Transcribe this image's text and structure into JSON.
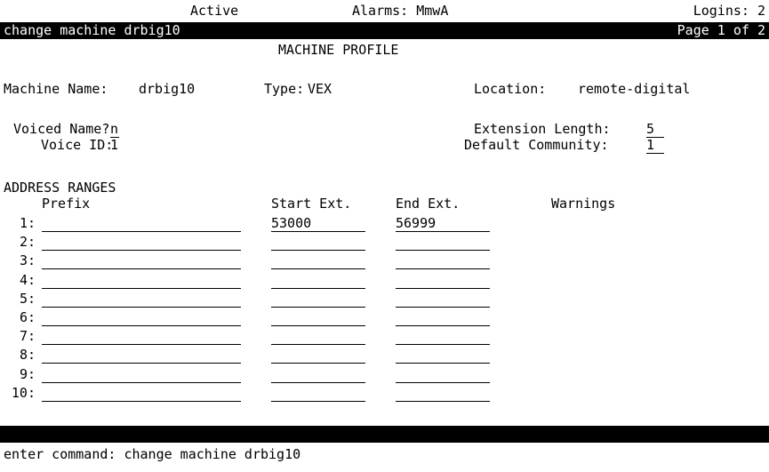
{
  "status": {
    "state": "Active",
    "alarms": "Alarms: MmwA",
    "logins": "Logins: 2"
  },
  "title_bar": {
    "command": "change machine drbig10",
    "page": "Page 1 of 2"
  },
  "form_title": "MACHINE PROFILE",
  "machine": {
    "name_label": "Machine Name:",
    "name_value": "drbig10",
    "type_label": "Type:",
    "type_value": "VEX",
    "location_label": "Location:",
    "location_value": "remote-digital"
  },
  "voice": {
    "voiced_name_label": "Voiced Name?",
    "voiced_name_value": "n",
    "voice_id_label": "Voice ID:",
    "voice_id_value": "1"
  },
  "ext": {
    "length_label": "Extension Length:",
    "length_value": "5",
    "community_label": "Default Community:",
    "community_value": "1"
  },
  "ranges": {
    "section_label": "ADDRESS RANGES",
    "headers": {
      "prefix": "Prefix",
      "start": "Start Ext.",
      "end": "End Ext.",
      "warnings": "Warnings"
    },
    "rows": [
      {
        "num": "1:",
        "prefix": "",
        "start": "53000",
        "end": "56999"
      },
      {
        "num": "2:",
        "prefix": "",
        "start": "",
        "end": ""
      },
      {
        "num": "3:",
        "prefix": "",
        "start": "",
        "end": ""
      },
      {
        "num": "4:",
        "prefix": "",
        "start": "",
        "end": ""
      },
      {
        "num": "5:",
        "prefix": "",
        "start": "",
        "end": ""
      },
      {
        "num": "6:",
        "prefix": "",
        "start": "",
        "end": ""
      },
      {
        "num": "7:",
        "prefix": "",
        "start": "",
        "end": ""
      },
      {
        "num": "8:",
        "prefix": "",
        "start": "",
        "end": ""
      },
      {
        "num": "9:",
        "prefix": "",
        "start": "",
        "end": ""
      },
      {
        "num": "10:",
        "prefix": "",
        "start": "",
        "end": ""
      }
    ]
  },
  "command_line": "enter command: change machine drbig10"
}
